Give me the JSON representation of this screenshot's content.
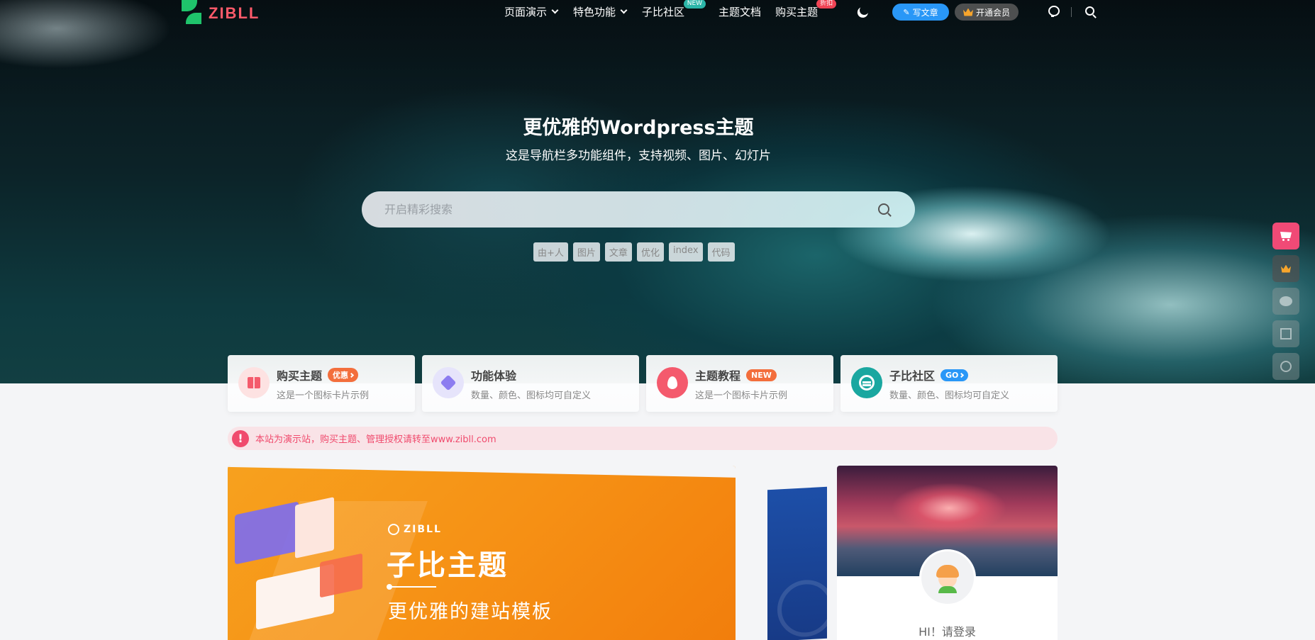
{
  "nav": {
    "logo_text": "ZIBLL",
    "menu": [
      {
        "label": "页面演示",
        "dropdown": true
      },
      {
        "label": "特色功能",
        "dropdown": true
      },
      {
        "label": "子比社区",
        "badge": "NEW"
      },
      {
        "label": "主题文档"
      },
      {
        "label": "购买主题",
        "badge": "折扣"
      }
    ],
    "write_label": "写文章",
    "vip_label": "开通会员"
  },
  "hero": {
    "title": "更优雅的Wordpress主题",
    "subtitle": "这是导航栏多功能组件，支持视频、图片、幻灯片",
    "search_placeholder": "开启精彩搜索",
    "tags": [
      "由+人",
      "图片",
      "文章",
      "优化",
      "index",
      "代码"
    ]
  },
  "cards": [
    {
      "title": "购买主题",
      "pill": "优惠",
      "pill_color": "#f36e3c",
      "desc": "这是一个图标卡片示例",
      "icon": "gift-icon",
      "icon_bg": "#fde2e2"
    },
    {
      "title": "功能体验",
      "pill": "",
      "desc": "数量、颜色、图标均可自定义",
      "icon": "diamond-icon",
      "icon_bg": "#e6e4fb"
    },
    {
      "title": "主题教程",
      "pill": "NEW",
      "pill_color": "#f36e3c",
      "desc": "这是一个图标卡片示例",
      "icon": "fire-icon",
      "icon_bg": "#f45a6d"
    },
    {
      "title": "子比社区",
      "pill": "GO",
      "pill_color": "#2997f7",
      "desc": "数量、颜色、图标均可自定义",
      "icon": "globe-icon",
      "icon_bg": "#1aa7a0"
    }
  ],
  "notice": {
    "text": "本站为演示站，购买主题、管理授权请转至www.zibll.com"
  },
  "banner": {
    "logo": "ZIBLL",
    "title": "子比主题",
    "slogan": "更优雅的建站模板"
  },
  "user": {
    "greeting": "HI！请登录"
  },
  "colors": {
    "accent_blue": "#2997f7",
    "accent_pink": "#f04a76",
    "brand_green": "#1fc36b"
  }
}
